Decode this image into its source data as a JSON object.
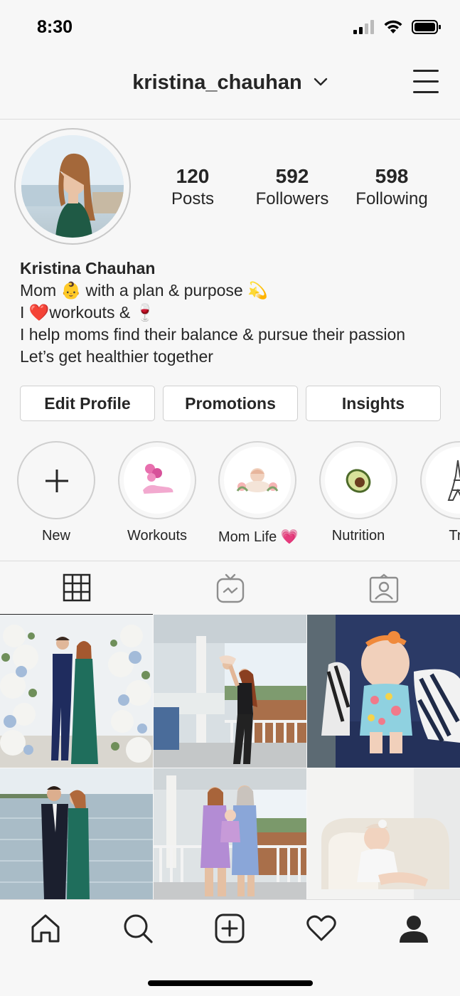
{
  "status_bar": {
    "time": "8:30"
  },
  "header": {
    "username": "kristina_chauhan"
  },
  "profile": {
    "stats": [
      {
        "value": "120",
        "label": "Posts"
      },
      {
        "value": "592",
        "label": "Followers"
      },
      {
        "value": "598",
        "label": "Following"
      }
    ],
    "name": "Kristina Chauhan",
    "bio_lines": [
      "Mom 👶 with a plan & purpose 💫",
      "I ❤️workouts & 🍷",
      "I help moms find their balance & pursue their passion",
      "Let’s get healthier together"
    ]
  },
  "buttons": {
    "edit": "Edit Profile",
    "promotions": "Promotions",
    "insights": "Insights"
  },
  "highlights": [
    {
      "label": "New",
      "icon": "plus-icon"
    },
    {
      "label": "Workouts",
      "icon": "dumbbell-sneaker-icon"
    },
    {
      "label": "Mom Life 💗",
      "icon": "baby-flowers-icon"
    },
    {
      "label": "Nutrition",
      "icon": "avocado-icon"
    },
    {
      "label": "Tra",
      "icon": "eiffel-tower-icon"
    }
  ],
  "tabs": [
    "grid-icon",
    "igtv-icon",
    "tagged-icon"
  ],
  "grid_posts": [
    {
      "description": "couple-floral-arch"
    },
    {
      "description": "porch-mom-baby"
    },
    {
      "description": "baby-on-couch"
    },
    {
      "description": "couple-waterfront"
    },
    {
      "description": "women-with-baby-porch"
    },
    {
      "description": "baby-in-white-chair"
    }
  ],
  "bottom_nav": [
    "home-icon",
    "search-icon",
    "add-post-icon",
    "activity-heart-icon",
    "profile-icon"
  ],
  "colors": {
    "text": "#262626",
    "background": "#f7f7f7",
    "border": "#dcdcdc",
    "notification_dot": "#e0405a"
  }
}
